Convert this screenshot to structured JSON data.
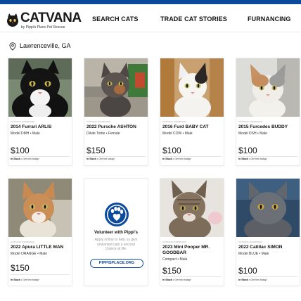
{
  "brand": {
    "name": "CATVANA",
    "tagline": "by Pippi's Place Pet Rescue",
    "accent_color": "#0b4a9c"
  },
  "nav": {
    "items": [
      {
        "label": "SEARCH CATS"
      },
      {
        "label": "TRADE CAT STORIES"
      },
      {
        "label": "FURNANCING"
      }
    ]
  },
  "location": {
    "icon": "map-pin-icon",
    "label": "Lawrenceville, GA"
  },
  "listings": [
    {
      "eyebrow": "CATVANA PURRIFIED",
      "title": "2014 Furrari ARLIS",
      "model": "Model DMH • Male",
      "price": "$100",
      "stock_label": "In Stock",
      "stock_note": " • Get him today!"
    },
    {
      "eyebrow": "CATVANA PURRIFIED",
      "title": "2022 Pursche ASHTON",
      "model": "Dilute Tortie • Female",
      "price": "$150",
      "stock_label": "In Stock",
      "stock_note": " • Get her today!"
    },
    {
      "eyebrow": "CATVANA PURRIFIED",
      "title": "2016 Furd BABY CAT",
      "model": "Model COW • Male",
      "price": "$100",
      "stock_label": "In Stock",
      "stock_note": " • Get him today!"
    },
    {
      "eyebrow": "CATVANA PURRIFIED",
      "title": "2015 Furcedes BUDDY",
      "model": "Model DSH • Male",
      "price": "$100",
      "stock_label": "In Stock",
      "stock_note": " • Get him today!"
    },
    {
      "eyebrow": "CATVANA PURRIFIED",
      "title": "2022 Apura LITTLE MAN",
      "model": "Model ORANGE • Male",
      "price": "$150",
      "stock_label": "In Stock",
      "stock_note": " • Get him today!"
    },
    {
      "eyebrow": "CATVANA PURRIFIED",
      "title": "2023 Mini Pooper MR. GOODBAR",
      "model": "Compact • Male",
      "price": "$150",
      "stock_label": "In Stock",
      "stock_note": " • Get him today!"
    },
    {
      "eyebrow": "CATVANA PURRIFIED",
      "title": "2022 Catillac SIMON",
      "model": "Model BLUE • Male",
      "price": "$100",
      "stock_label": "In Stock",
      "stock_note": " • Get him today!"
    }
  ],
  "promo": {
    "icon": "paw-heart-icon",
    "title": "Volunteer with Pippi's",
    "text": "Apply online to help us give unwanted cats a second chance at life.",
    "button_label": "PIPPISPLACE.ORG"
  }
}
